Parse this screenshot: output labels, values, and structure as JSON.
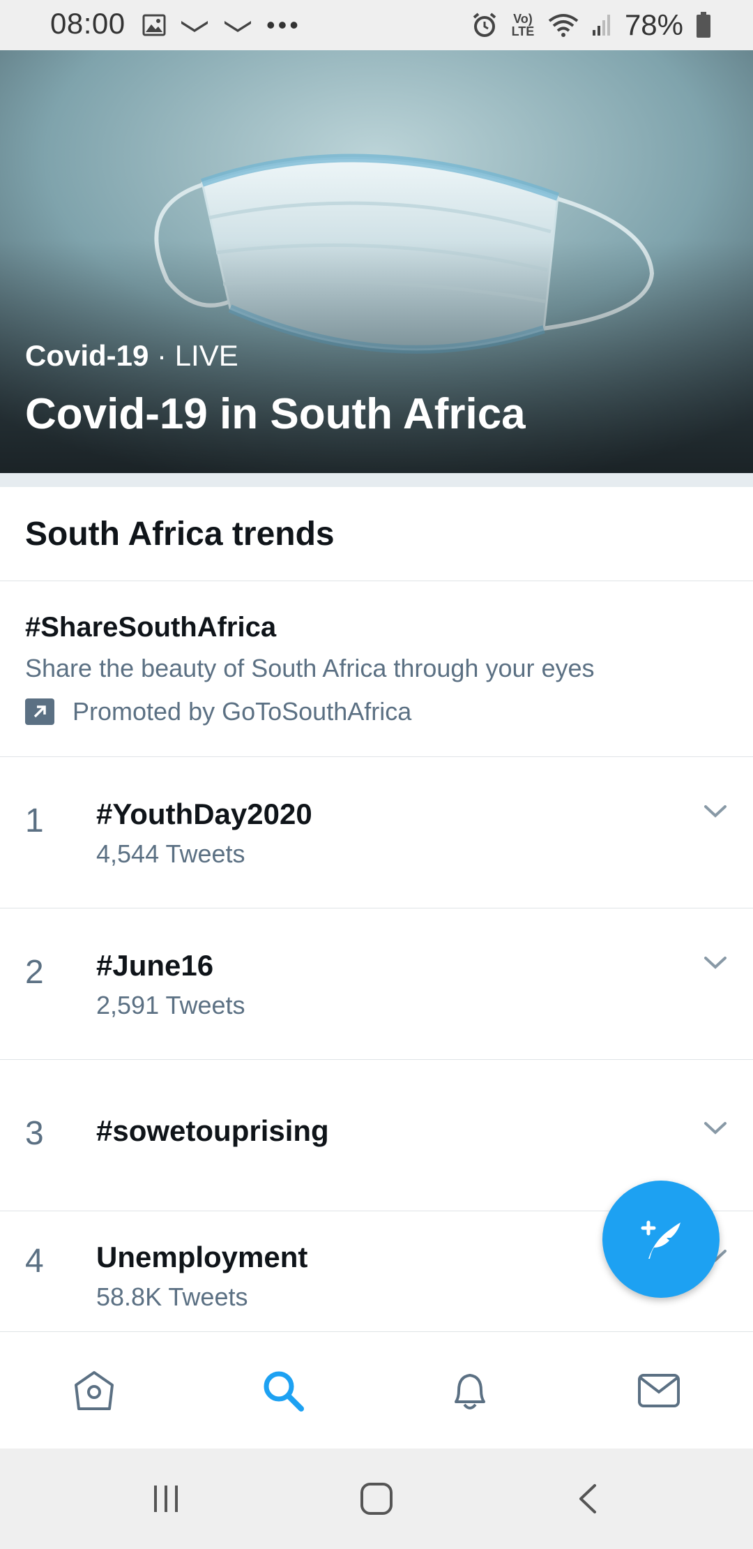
{
  "status_bar": {
    "time": "08:00",
    "battery": "78%",
    "network": "Vo) LTE",
    "more": "•••"
  },
  "hero": {
    "category": "Covid-19",
    "separator": " · ",
    "live": "LIVE",
    "title": "Covid-19 in South Africa"
  },
  "trends": {
    "header": "South Africa trends",
    "promoted": {
      "hashtag": "#ShareSouthAfrica",
      "description": "Share the beauty of South Africa through your eyes",
      "promoted_by": "Promoted by GoToSouthAfrica"
    },
    "items": [
      {
        "rank": "1",
        "name": "#YouthDay2020",
        "count": "4,544 Tweets"
      },
      {
        "rank": "2",
        "name": "#June16",
        "count": "2,591 Tweets"
      },
      {
        "rank": "3",
        "name": "#sowetouprising",
        "count": ""
      },
      {
        "rank": "4",
        "name": "Unemployment",
        "count": "58.8K Tweets"
      }
    ]
  },
  "fab": {
    "icon": "compose-tweet-icon"
  },
  "bottom_nav": {
    "items": [
      {
        "icon": "home-icon",
        "active": false
      },
      {
        "icon": "search-icon",
        "active": true
      },
      {
        "icon": "notifications-bell-icon",
        "active": false
      },
      {
        "icon": "messages-mail-icon",
        "active": false
      }
    ]
  },
  "colors": {
    "accent": "#1da1f2",
    "secondary_text": "#5b7083",
    "primary_text": "#0f1419",
    "divider": "#dfe3e6"
  }
}
